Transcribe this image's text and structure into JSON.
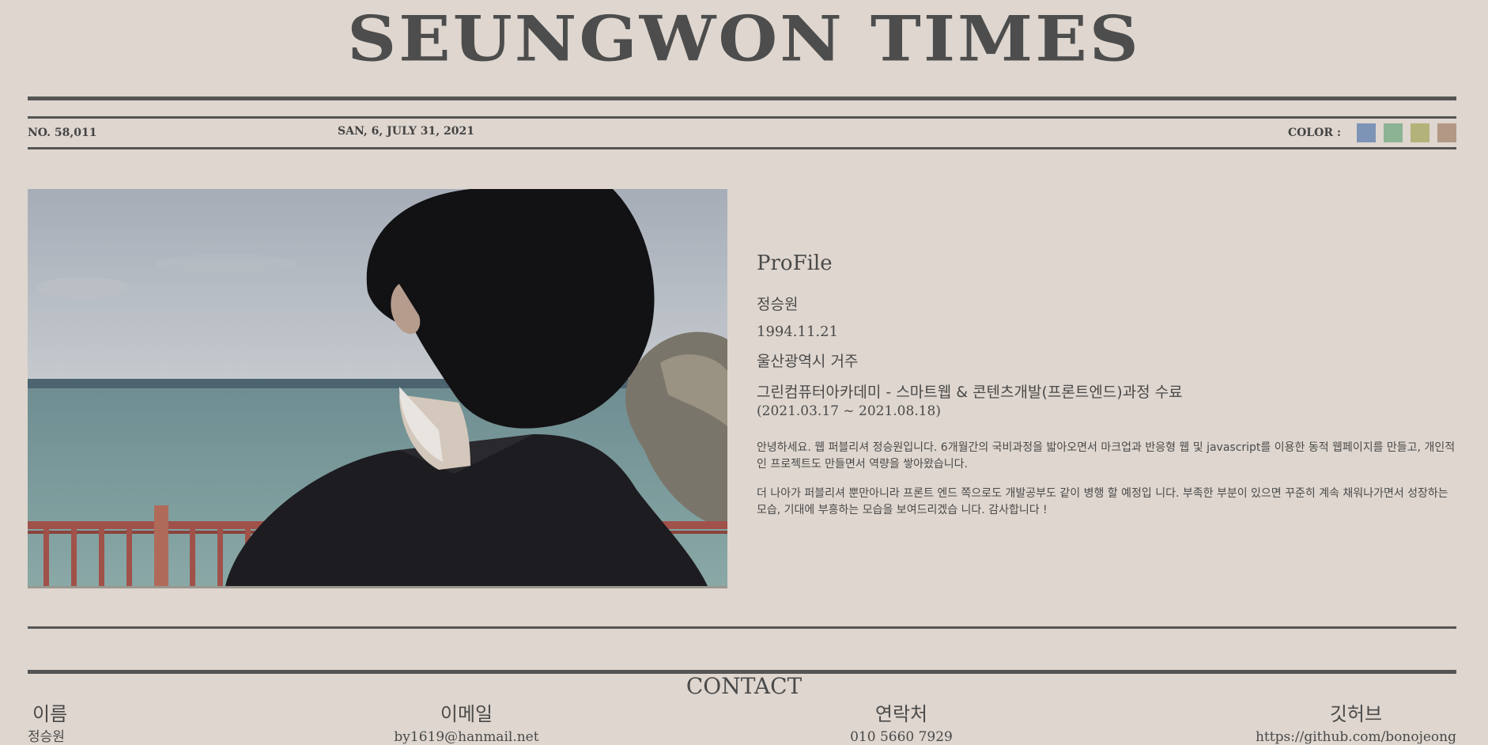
{
  "masthead": {
    "title": "SEUNGWON TIMES"
  },
  "infobar": {
    "issue": "NO. 58,011",
    "date": "SAN, 6, JULY 31, 2021",
    "color_label": "COLOR :",
    "swatches": [
      "#7e94b7",
      "#8cb393",
      "#b2b27a",
      "#b39886"
    ]
  },
  "profile": {
    "heading": "ProFile",
    "name": "정승원",
    "birth": "1994.11.21",
    "location": "울산광역시 거주",
    "course": "그린컴퓨터아카데미 - 스마트웹 & 콘텐츠개발(프론트엔드)과정 수료",
    "period": "(2021.03.17 ~ 2021.08.18)",
    "para1": "안녕하세요. 웹 퍼블리셔 정승원입니다. 6개월간의 국비과정을 밟아오면서 마크업과 반응형 웹 및 javascript를 이용한 동적 웹페이지를 만들고, 개인적인 프로젝트도 만들면서 역량을 쌓아왔습니다.",
    "para2": "더 나아가 퍼블리셔 뿐만아니라 프론트 엔드 쪽으로도 개발공부도 같이 병행 할 예정입 니다. 부족한 부분이 있으면 꾸준히 계속 채워나가면서 성장하는 모습, 기대에 부흥하는 모습을 보여드리겠습 니다. 감사합니다 !"
  },
  "contact": {
    "title": "CONTACT",
    "name_label": "이름",
    "name_value": "정승원",
    "email_label": "이메일",
    "email_value": "by1619@hanmail.net",
    "phone_label": "연락처",
    "phone_value": "010 5660 7929",
    "github_label": "깃허브",
    "github_value": "https://github.com/bonojeong"
  }
}
